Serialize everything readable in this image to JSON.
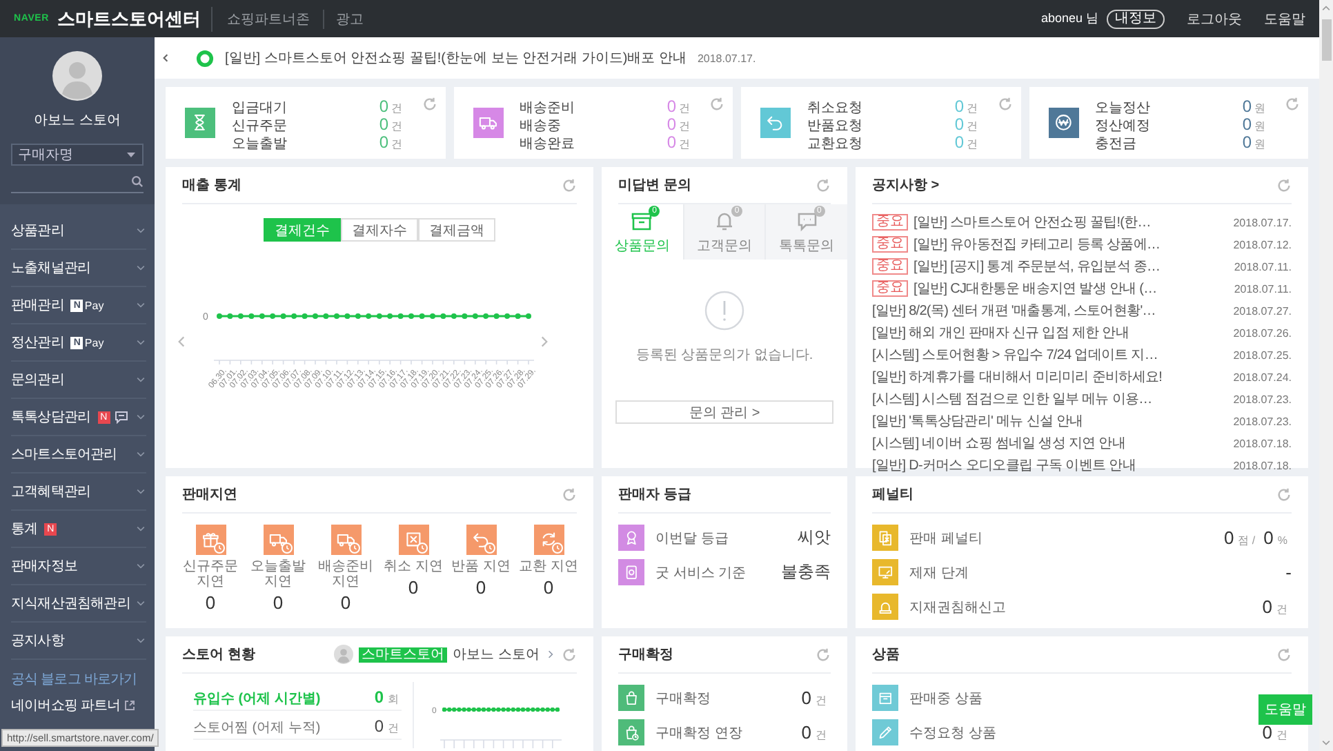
{
  "top_bar": {
    "logo": "NAVER",
    "title": "스마트스토어센터",
    "nav": [
      "쇼핑파트너존",
      "광고"
    ],
    "user": "aboneu 님",
    "user_badge": "내정보",
    "links": [
      "로그아웃",
      "도움말"
    ]
  },
  "sidebar": {
    "store_name": "아보느 스토어",
    "filter": "구매자명",
    "menu": [
      {
        "label": "상품관리"
      },
      {
        "label": "노출채널관리"
      },
      {
        "label": "판매관리",
        "badges": [
          {
            "kind": "npay",
            "mark": "N",
            "text": "Pay"
          }
        ]
      },
      {
        "label": "정산관리",
        "badges": [
          {
            "kind": "npay",
            "mark": "N",
            "text": "Pay"
          }
        ]
      },
      {
        "label": "문의관리"
      },
      {
        "label": "톡톡상담관리",
        "badges": [
          {
            "kind": "new",
            "text": "N"
          },
          {
            "kind": "chat"
          }
        ]
      },
      {
        "label": "스마트스토어관리"
      },
      {
        "label": "고객혜택관리"
      },
      {
        "label": "통계",
        "badges": [
          {
            "kind": "new",
            "text": "N"
          }
        ]
      },
      {
        "label": "판매자정보"
      },
      {
        "label": "지식재산권침해관리"
      },
      {
        "label": "공지사항"
      }
    ],
    "links": [
      {
        "kind": "blog",
        "text": "공식 블로그 바로가기"
      },
      {
        "kind": "external",
        "text": "네이버쇼핑 파트너"
      }
    ]
  },
  "notice_bar": {
    "text": "[일반] 스마트스토어 안전쇼핑 꿀팁!(한눈에 보는 안전거래 가이드)배포 안내",
    "date": "2018.07.17."
  },
  "summary_cards": [
    {
      "kind": "hourglass",
      "color": "#4cbf7c",
      "refresh": true,
      "rows": [
        {
          "label": "입금대기",
          "value": "0",
          "unit": "건"
        },
        {
          "label": "신규주문",
          "value": "0",
          "unit": "건"
        },
        {
          "label": "오늘출발",
          "value": "0",
          "unit": "건"
        }
      ]
    },
    {
      "kind": "truck",
      "color": "#d688e6",
      "refresh": true,
      "rows": [
        {
          "label": "배송준비",
          "value": "0",
          "unit": "건"
        },
        {
          "label": "배송중",
          "value": "0",
          "unit": "건"
        },
        {
          "label": "배송완료",
          "value": "0",
          "unit": "건"
        }
      ]
    },
    {
      "kind": "return",
      "color": "#62c8d6",
      "refresh": true,
      "rows": [
        {
          "label": "취소요청",
          "value": "0",
          "unit": "건"
        },
        {
          "label": "반품요청",
          "value": "0",
          "unit": "건"
        },
        {
          "label": "교환요청",
          "value": "0",
          "unit": "건"
        }
      ]
    },
    {
      "kind": "won",
      "color": "#4f7898",
      "refresh": true,
      "rows": [
        {
          "label": "오늘정산",
          "value": "0",
          "unit": "원"
        },
        {
          "label": "정산예정",
          "value": "0",
          "unit": "원"
        },
        {
          "label": "충전금",
          "value": "0",
          "unit": "원"
        }
      ]
    }
  ],
  "sales_stats": {
    "title": "매출 통계",
    "refresh": true,
    "tabs": [
      {
        "label": "결제건수",
        "selected": true
      },
      {
        "label": "결제자수",
        "selected": false
      },
      {
        "label": "결제금액",
        "selected": false
      }
    ],
    "x_labels": [
      "06.30.",
      "07.01.",
      "07.02.",
      "07.03.",
      "07.04.",
      "07.05.",
      "07.06.",
      "07.07.",
      "07.08.",
      "07.09.",
      "07.10.",
      "07.11.",
      "07.12.",
      "07.13.",
      "07.14.",
      "07.15.",
      "07.16.",
      "07.17.",
      "07.18.",
      "07.19.",
      "07.20.",
      "07.21.",
      "07.22.",
      "07.23.",
      "07.24.",
      "07.25.",
      "07.26.",
      "07.27.",
      "07.28.",
      "07.29."
    ],
    "y_tick_label": "0"
  },
  "inquiries": {
    "title": "미답변 문의",
    "refresh": true,
    "tabs": [
      {
        "kind": "box",
        "label": "상품문의",
        "count": "0",
        "selected": true
      },
      {
        "kind": "bell",
        "label": "고객문의",
        "count": "0",
        "selected": false
      },
      {
        "kind": "chat",
        "label": "톡톡문의",
        "count": "0",
        "selected": false
      }
    ],
    "empty_message": "등록된 상품문의가 없습니다.",
    "button": "문의 관리 >"
  },
  "notices": {
    "title": "공지사항 >",
    "refresh": true,
    "items": [
      {
        "tag": "중요",
        "text": "[일반] 스마트스토어 안전쇼핑 꿀팁!(한…",
        "date": "2018.07.17."
      },
      {
        "tag": "중요",
        "text": "[일반] 유아동전집 카테고리 등록 상품에…",
        "date": "2018.07.12."
      },
      {
        "tag": "중요",
        "text": "[일반] [공지] 통계 주문분석, 유입분석 종…",
        "date": "2018.07.11."
      },
      {
        "tag": "중요",
        "text": "[일반] CJ대한통운 배송지연 발생 안내 (…",
        "date": "2018.07.11."
      },
      {
        "text": "[일반] 8/2(목) 센터 개편 '매출통계, 스토어현황'…",
        "date": "2018.07.27."
      },
      {
        "text": "[일반] 해외 개인 판매자 신규 입점 제한 안내",
        "date": "2018.07.26."
      },
      {
        "text": "[시스템] 스토어현황 > 유입수 7/24 업데이트 지…",
        "date": "2018.07.25."
      },
      {
        "text": "[일반] 하계휴가를 대비해서 미리미리 준비하세요!",
        "date": "2018.07.24."
      },
      {
        "text": "[시스템] 시스템 점검으로 인한 일부 메뉴 이용…",
        "date": "2018.07.23."
      },
      {
        "text": "[일반] '톡톡상담관리' 메뉴 신설 안내",
        "date": "2018.07.23."
      },
      {
        "text": "[시스템] 네이버 쇼핑 썸네일 생성 지연 안내",
        "date": "2018.07.18."
      },
      {
        "text": "[일반] D-커머스 오디오클립 구독 이벤트 안내",
        "date": "2018.07.18."
      }
    ]
  },
  "sales_delay": {
    "title": "판매지연",
    "refresh": true,
    "items": [
      {
        "kind": "gift",
        "label": "신규주문 지연",
        "value": "0"
      },
      {
        "kind": "truck",
        "label": "오늘출발 지연",
        "value": "0"
      },
      {
        "kind": "truck",
        "label": "배송준비 지연",
        "value": "0"
      },
      {
        "kind": "cancel",
        "label": "취소 지연",
        "value": "0"
      },
      {
        "kind": "return",
        "label": "반품 지연",
        "value": "0"
      },
      {
        "kind": "exchange",
        "label": "교환 지연",
        "value": "0"
      }
    ]
  },
  "seller_grade": {
    "title": "판매자 등급",
    "refresh": false,
    "rows": [
      {
        "kind": "medal",
        "label": "이번달 등급",
        "values": [
          {
            "value": "씨앗"
          }
        ]
      },
      {
        "kind": "badge",
        "label": "굿 서비스 기준",
        "values": [
          {
            "value": "불충족"
          }
        ]
      }
    ]
  },
  "penalty": {
    "title": "페널티",
    "refresh": true,
    "rows": [
      {
        "kind": "document",
        "label": "판매 페널티",
        "values": [
          {
            "value": "0",
            "unit": "점 /"
          },
          {
            "value": "0",
            "unit": "%"
          }
        ]
      },
      {
        "kind": "monitor",
        "label": "제재 단계",
        "values": [
          {
            "value": "-"
          }
        ]
      },
      {
        "kind": "siren",
        "label": "지재권침해신고",
        "values": [
          {
            "value": "0",
            "unit": "건"
          }
        ]
      }
    ]
  },
  "store_status": {
    "title": "스토어 현황",
    "refresh": true,
    "badge": "스마트스토어",
    "store": "아보느 스토어",
    "rows": [
      {
        "label": "유입수 (어제 시간별)",
        "value": "0",
        "unit": "회",
        "highlight": true
      },
      {
        "label": "스토어찜 (어제 누적)",
        "value": "0",
        "unit": "건",
        "highlight": false
      }
    ],
    "y_tick_label": "0"
  },
  "purchase_confirm": {
    "title": "구매확정",
    "refresh": true,
    "rows": [
      {
        "kind": "bag",
        "label": "구매확정",
        "values": [
          {
            "value": "0",
            "unit": "건"
          }
        ]
      },
      {
        "kind": "bag-clock",
        "label": "구매확정 연장",
        "values": [
          {
            "value": "0",
            "unit": "건"
          }
        ]
      }
    ]
  },
  "products": {
    "title": "상품",
    "refresh": true,
    "rows": [
      {
        "kind": "box",
        "label": "판매중 상품"
      },
      {
        "kind": "pencil",
        "label": "수정요청 상품",
        "values": [
          {
            "value": "0",
            "unit": "건"
          }
        ]
      }
    ]
  },
  "help_button": "도움말",
  "status_url": "http://sell.smartstore.naver.com/"
}
